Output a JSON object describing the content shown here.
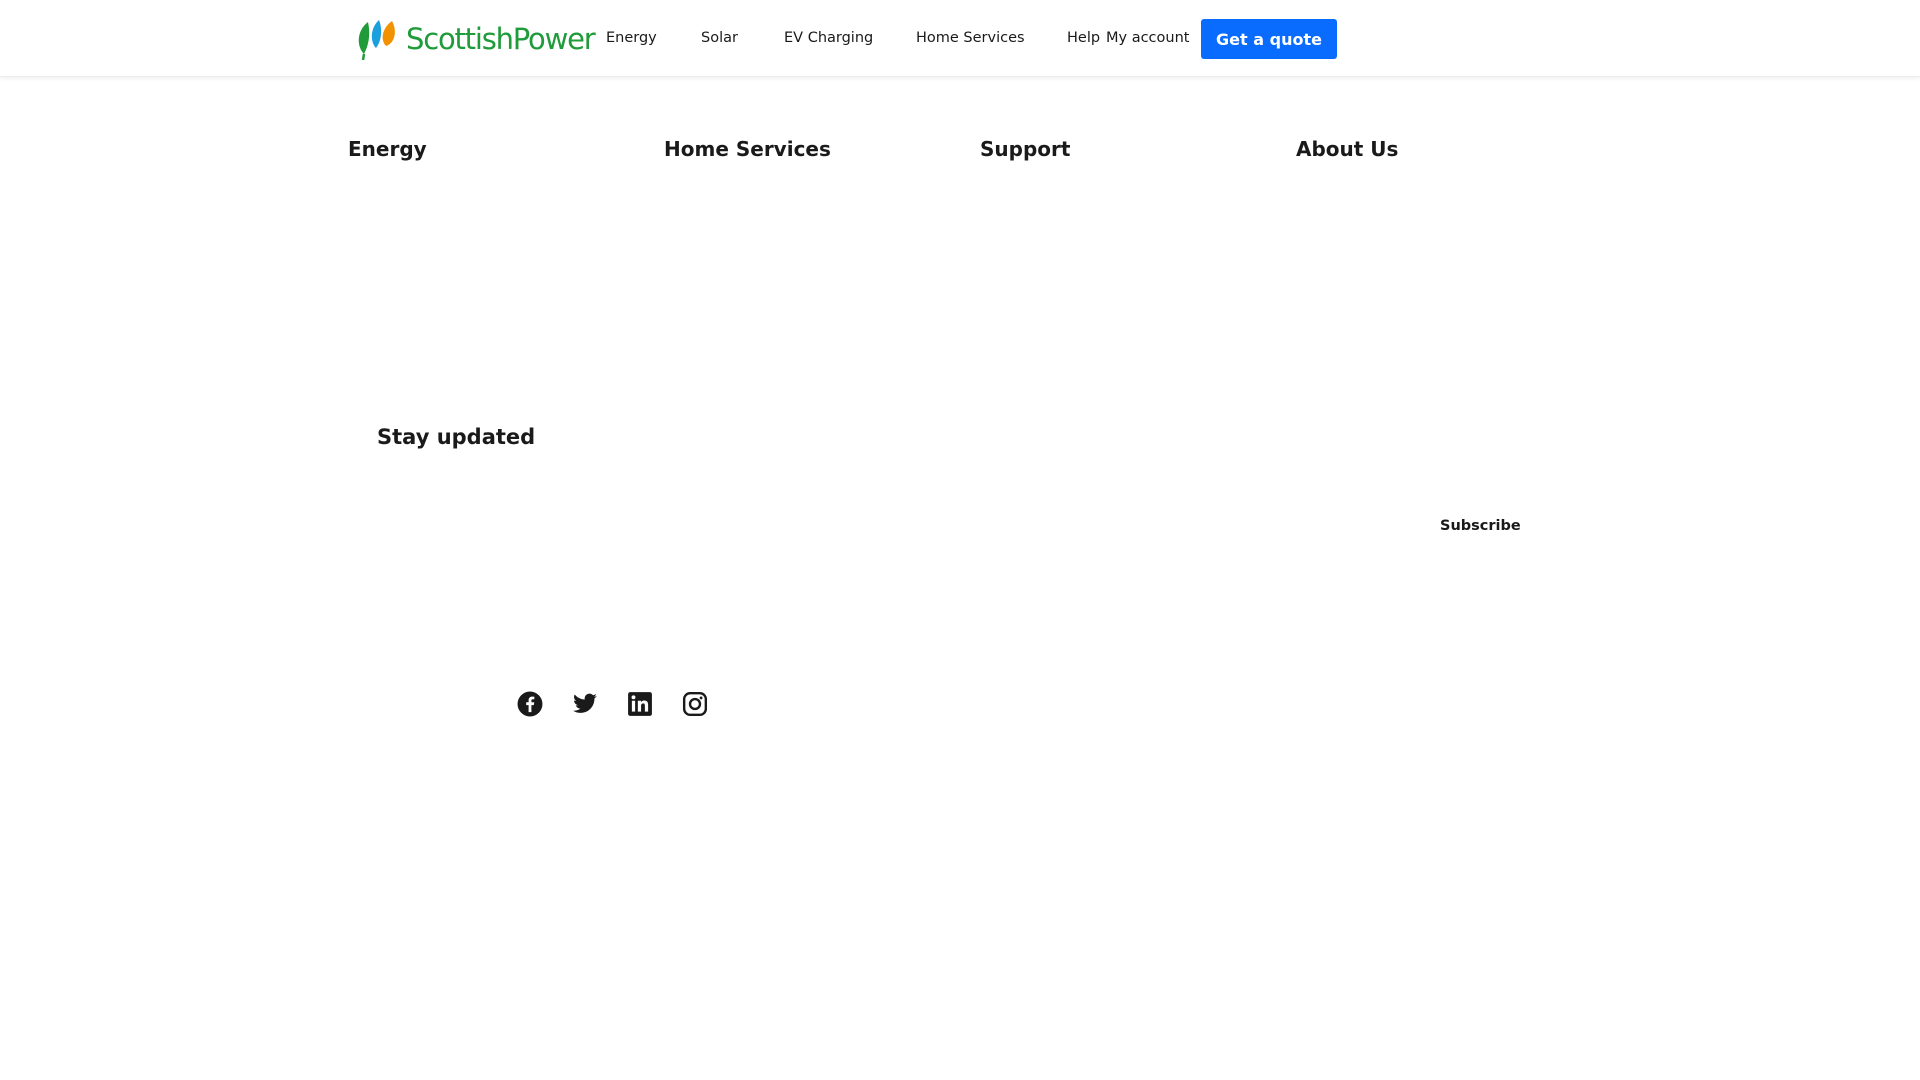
{
  "header": {
    "brand_name": "ScottishPower",
    "nav": [
      {
        "label": "Energy"
      },
      {
        "label": "Solar"
      },
      {
        "label": "EV Charging"
      },
      {
        "label": "Home Services"
      },
      {
        "label": "Help"
      }
    ],
    "account_label": "My account",
    "cta_label": "Get a quote"
  },
  "footer": {
    "columns": [
      {
        "heading": "Energy"
      },
      {
        "heading": "Home Services"
      },
      {
        "heading": "Support"
      },
      {
        "heading": "About Us"
      }
    ],
    "newsletter": {
      "title": "Stay updated",
      "subscribe_label": "Subscribe"
    },
    "social": [
      {
        "icon": "facebook-icon"
      },
      {
        "icon": "twitter-icon"
      },
      {
        "icon": "linkedin-icon"
      },
      {
        "icon": "instagram-icon"
      }
    ]
  },
  "colors": {
    "brand_green": "#1f9b3a",
    "brand_orange": "#f39200",
    "brand_blue": "#1aa0dc",
    "cta_blue": "#0a6cff",
    "text": "#1a1a1a"
  }
}
